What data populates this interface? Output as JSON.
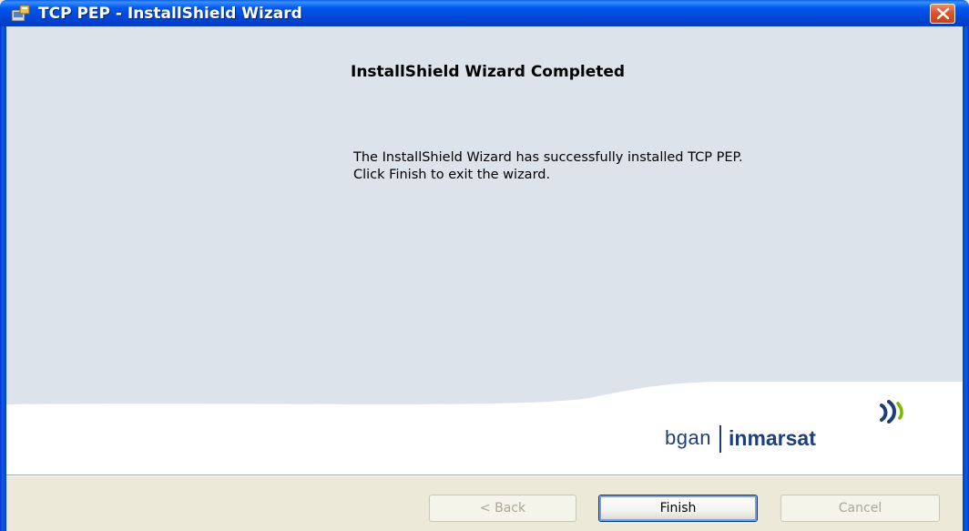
{
  "window": {
    "title": "TCP PEP - InstallShield Wizard"
  },
  "content": {
    "heading": "InstallShield Wizard Completed",
    "body_lines": [
      "The InstallShield Wizard has successfully installed TCP PEP.",
      "Click Finish to exit the wizard."
    ]
  },
  "logo": {
    "left_text": "bgan",
    "right_text": "inmarsat",
    "color": "#1e3f7a",
    "wave_color": "#7ab800"
  },
  "buttons": {
    "back": {
      "label": "< Back",
      "enabled": false
    },
    "finish": {
      "label": "Finish",
      "enabled": true,
      "default": true
    },
    "cancel": {
      "label": "Cancel",
      "enabled": false
    }
  },
  "colors": {
    "titlebar": "#0058ee",
    "close": "#d8572d",
    "panel": "#dde3ea",
    "footer": "#ece9d8"
  },
  "icons": {
    "title": "installer-icon",
    "close": "close-icon"
  }
}
